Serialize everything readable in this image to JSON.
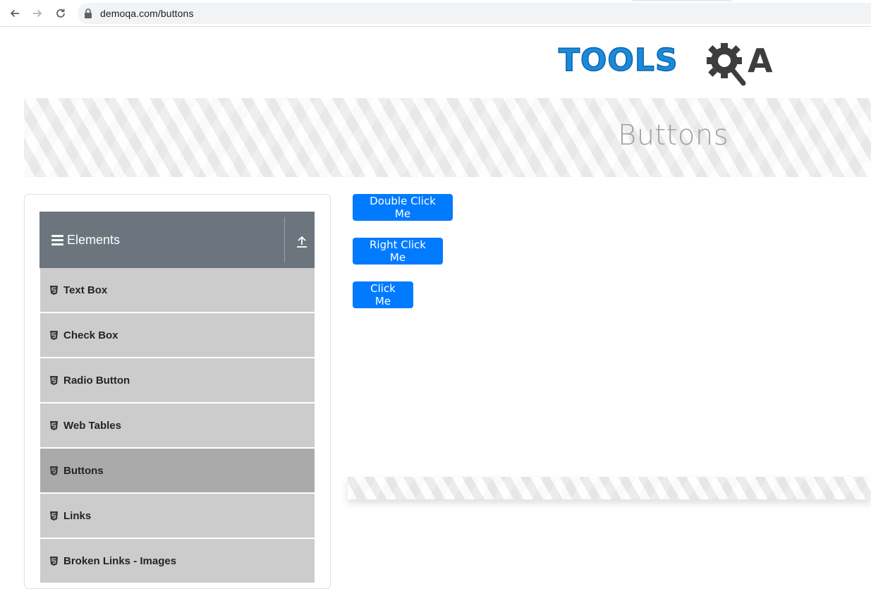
{
  "browser": {
    "url": "demoqa.com/buttons",
    "icons": [
      "back-arrow-icon",
      "forward-arrow-icon",
      "reload-icon",
      "lock-icon"
    ]
  },
  "logo": {
    "word": "TOOLS",
    "letter": "A",
    "colors": {
      "word": "#1a8bd8",
      "gear": "#3d3d3d"
    }
  },
  "banner": {
    "title": "Buttons"
  },
  "sidebar": {
    "group": {
      "label": "Elements",
      "icons": [
        "hamburger-icon",
        "upload-icon"
      ],
      "color": "#6c757d"
    },
    "items": [
      {
        "label": "Text Box",
        "active": false
      },
      {
        "label": "Check Box",
        "active": false
      },
      {
        "label": "Radio Button",
        "active": false
      },
      {
        "label": "Web Tables",
        "active": false
      },
      {
        "label": "Buttons",
        "active": true
      },
      {
        "label": "Links",
        "active": false
      },
      {
        "label": "Broken Links - Images",
        "active": false
      }
    ],
    "item_icon": "html5-icon",
    "colors": {
      "item": "#cccccc",
      "active_item": "#aaaaaa"
    }
  },
  "main": {
    "buttons": {
      "double_click": "Double Click Me",
      "right_click": "Right Click Me",
      "click": "Click Me"
    },
    "button_color": "#007bff"
  }
}
